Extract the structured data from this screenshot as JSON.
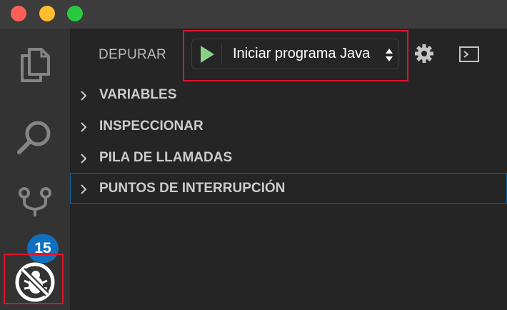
{
  "window": {
    "controls": [
      "close",
      "minimize",
      "maximize"
    ]
  },
  "activity_bar": {
    "items": [
      {
        "name": "explorer",
        "icon": "files-icon"
      },
      {
        "name": "search",
        "icon": "search-icon"
      },
      {
        "name": "source-control",
        "icon": "source-control-icon",
        "badge": "15"
      },
      {
        "name": "debug",
        "icon": "no-debug-icon",
        "active": true
      }
    ]
  },
  "debug_view": {
    "title": "DEPURAR",
    "launch_config": {
      "selected": "Iniciar programa Java",
      "start_icon": "play-icon",
      "dropdown_icon": "updown-arrows-icon"
    },
    "toolbar": {
      "settings_icon": "gear-icon",
      "console_icon": "debug-console-icon"
    },
    "sections": [
      {
        "label": "VARIABLES"
      },
      {
        "label": "INSPECCIONAR"
      },
      {
        "label": "PILA DE LLAMADAS"
      },
      {
        "label": "PUNTOS DE INTERRUPCIÓN",
        "focused": true
      }
    ]
  },
  "colors": {
    "highlight": "#e1122b",
    "badge": "#0e70c0",
    "play": "#89d185",
    "focus_border": "#0e639c"
  }
}
